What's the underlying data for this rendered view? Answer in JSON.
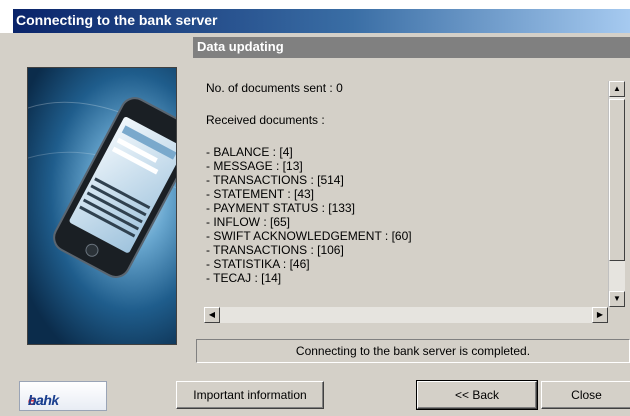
{
  "window": {
    "title": "Connecting to the bank server"
  },
  "section": {
    "header": "Data updating"
  },
  "report": {
    "sent_line": "No. of documents sent : 0",
    "received_heading": "Received documents :",
    "items": [
      "- BALANCE : [4]",
      "- MESSAGE : [13]",
      "- TRANSACTIONS : [514]",
      "- STATEMENT : [43]",
      "- PAYMENT STATUS : [133]",
      "- INFLOW : [65]",
      "- SWIFT ACKNOWLEDGEMENT : [60]",
      "- TRANSACTIONS : [106]",
      "- STATISTIKA : [46]",
      "- TECAJ : [14]"
    ]
  },
  "status": {
    "text": "Connecting to the bank server is completed."
  },
  "logo": {
    "left": "hal",
    "mid": "e",
    "right": "bank"
  },
  "buttons": {
    "important_info": "Important information",
    "back": "<< Back",
    "close": "Close"
  },
  "icons": {
    "scroll_up": "scroll-up-arrow-icon",
    "scroll_down": "scroll-down-arrow-icon",
    "scroll_left": "scroll-left-arrow-icon",
    "scroll_right": "scroll-right-arrow-icon"
  },
  "colors": {
    "title_bar_start": "#0a246a",
    "title_bar_end": "#a6caf0",
    "section_header": "#808080",
    "window_bg": "#d4d0c8"
  }
}
